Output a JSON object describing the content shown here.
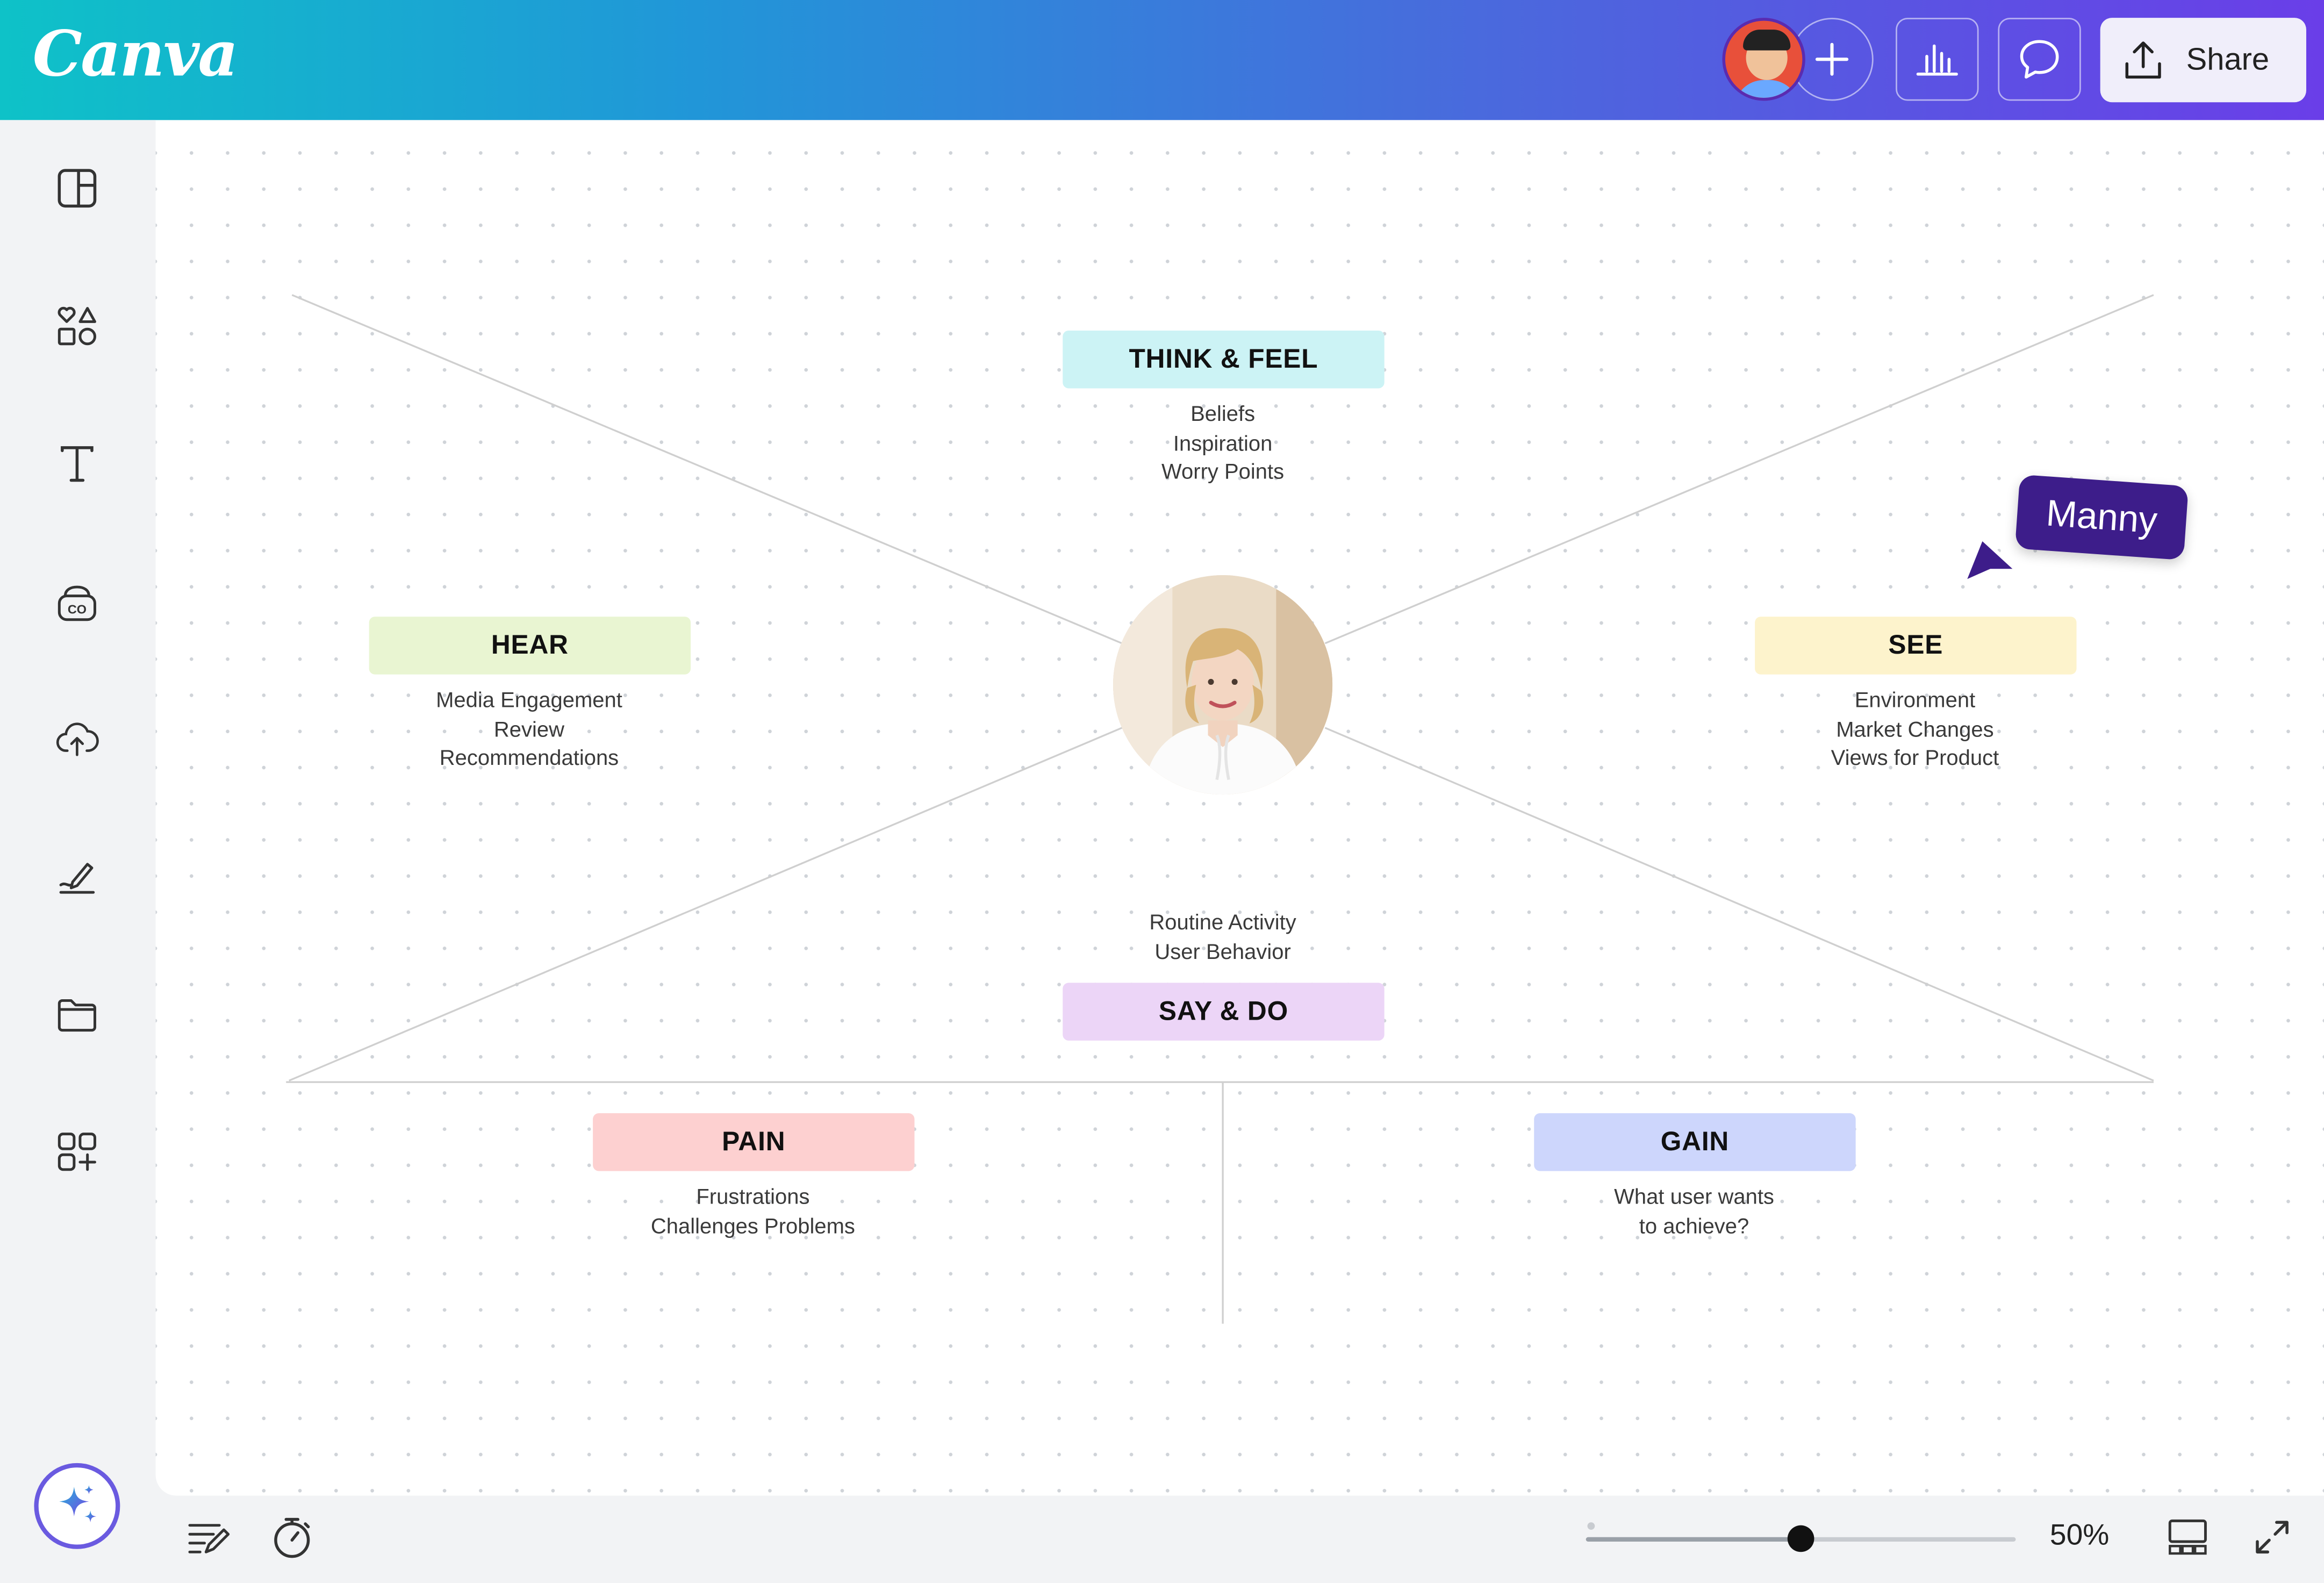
{
  "app": {
    "logo": "Canva",
    "share_label": "Share"
  },
  "board": {
    "think_feel": {
      "title": "THINK & FEEL",
      "lines": [
        "Beliefs",
        "Inspiration",
        "Worry Points"
      ],
      "color": "#ccf3f5"
    },
    "hear": {
      "title": "HEAR",
      "lines": [
        "Media Engagement",
        "Review",
        "Recommendations"
      ],
      "color": "#e9f5d2"
    },
    "see": {
      "title": "SEE",
      "lines": [
        "Environment",
        "Market Changes",
        "Views for Product"
      ],
      "color": "#fdf3cc"
    },
    "say_do": {
      "title": "SAY & DO",
      "lines": [
        "Routine Activity",
        "User Behavior"
      ],
      "color": "#ecd5f7"
    },
    "pain": {
      "title": "PAIN",
      "lines": [
        "Frustrations",
        "Challenges Problems"
      ],
      "color": "#fdd0d0"
    },
    "gain": {
      "title": "GAIN",
      "lines": [
        "What user wants",
        "to achieve?"
      ],
      "color": "#cdd6fc"
    }
  },
  "collaborator": {
    "name": "Manny",
    "color": "#3d1d8a"
  },
  "zoom": {
    "label": "50%",
    "value": 0.5
  },
  "icons": {
    "topbar": [
      "plus-icon",
      "insights-icon",
      "comment-icon",
      "share-upload-icon"
    ],
    "sidebar": [
      "design-icon",
      "elements-icon",
      "text-icon",
      "brand-icon",
      "uploads-icon",
      "draw-icon",
      "projects-icon",
      "apps-icon",
      "magic-icon"
    ],
    "bottombar": [
      "notes-icon",
      "timer-icon",
      "grid-view-icon",
      "fullscreen-icon"
    ]
  }
}
